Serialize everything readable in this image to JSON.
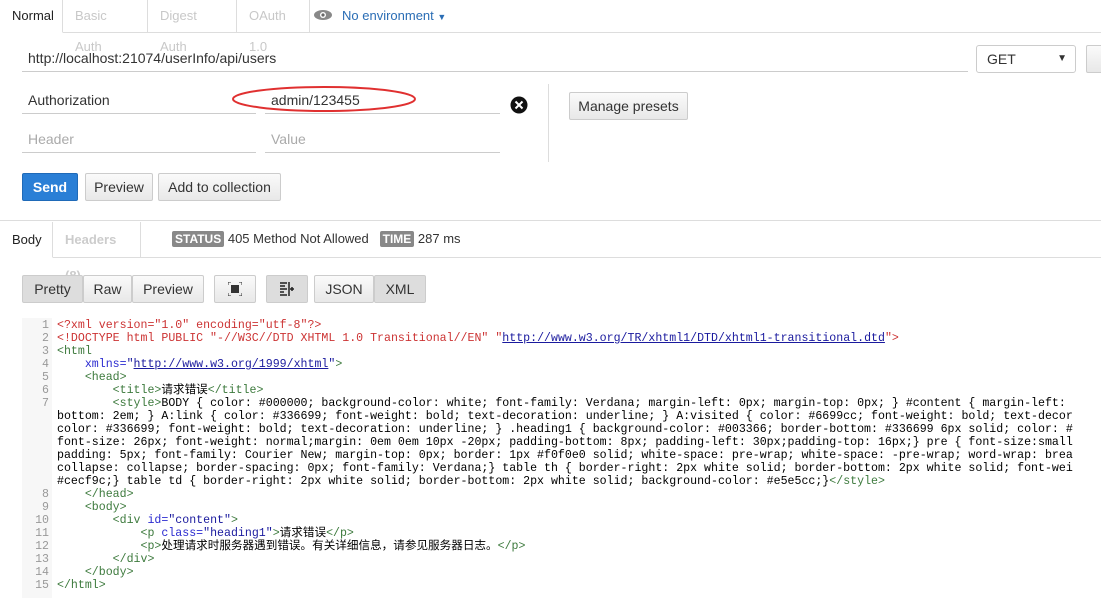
{
  "request_tabs": [
    "Normal",
    "Basic Auth",
    "Digest Auth",
    "OAuth 1.0"
  ],
  "environment": {
    "icon": "eye-icon",
    "label": "No environment"
  },
  "url": "http://localhost:21074/userInfo/api/users",
  "method": "GET",
  "headers": [
    {
      "key": "Authorization",
      "value": "admin/123455"
    },
    {
      "key_placeholder": "Header",
      "value_placeholder": "Value"
    }
  ],
  "manage_presets": "Manage presets",
  "actions": {
    "send": "Send",
    "preview": "Preview",
    "add": "Add to collection"
  },
  "response_tabs": [
    "Body",
    "Headers (8)"
  ],
  "status": {
    "label": "STATUS",
    "value": "405 Method Not Allowed",
    "time_label": "TIME",
    "time": "287 ms"
  },
  "view_modes": [
    "Pretty",
    "Raw",
    "Preview"
  ],
  "formats": [
    "JSON",
    "XML"
  ],
  "colors": {
    "send": "#2a7fd6",
    "highlight_ellipse": "#e03030"
  },
  "code": [
    {
      "n": "1",
      "t": [
        [
          "pi",
          "<?xml version=\"1.0\" encoding=\"utf-8\"?>"
        ]
      ]
    },
    {
      "n": "2",
      "t": [
        [
          "pi",
          "<!DOCTYPE html PUBLIC \"-//W3C//DTD XHTML 1.0 Transitional//EN\" \""
        ],
        [
          "url",
          "http://www.w3.org/TR/xhtml1/DTD/xhtml1-transitional.dtd"
        ],
        [
          "pi",
          "\">"
        ]
      ]
    },
    {
      "n": "3",
      "t": [
        [
          "tag",
          "<html"
        ]
      ]
    },
    {
      "n": "4",
      "t": [
        [
          "attr",
          "    xmlns="
        ],
        [
          "str",
          "\""
        ],
        [
          "url",
          "http://www.w3.org/1999/xhtml"
        ],
        [
          "str",
          "\""
        ],
        [
          "tag",
          ">"
        ]
      ]
    },
    {
      "n": "5",
      "t": [
        [
          "tag",
          "    <head>"
        ]
      ]
    },
    {
      "n": "6",
      "t": [
        [
          "tag",
          "        <title>"
        ],
        [
          "txt",
          "请求错误"
        ],
        [
          "tag",
          "</title>"
        ]
      ]
    },
    {
      "n": "7",
      "t": [
        [
          "tag",
          "        <style>"
        ],
        [
          "txt",
          "BODY { color: #000000; background-color: white; font-family: Verdana; margin-left: 0px; margin-top: 0px; } #content { margin-left:"
        ]
      ]
    },
    {
      "n": "",
      "t": [
        [
          "txt",
          "bottom: 2em; } A:link { color: #336699; font-weight: bold; text-decoration: underline; } A:visited { color: #6699cc; font-weight: bold; text-decor"
        ]
      ]
    },
    {
      "n": "",
      "t": [
        [
          "txt",
          "color: #336699; font-weight: bold; text-decoration: underline; } .heading1 { background-color: #003366; border-bottom: #336699 6px solid; color: #"
        ]
      ]
    },
    {
      "n": "",
      "t": [
        [
          "txt",
          "font-size: 26px; font-weight: normal;margin: 0em 0em 10px -20px; padding-bottom: 8px; padding-left: 30px;padding-top: 16px;} pre { font-size:small"
        ]
      ]
    },
    {
      "n": "",
      "t": [
        [
          "txt",
          "padding: 5px; font-family: Courier New; margin-top: 0px; border: 1px #f0f0e0 solid; white-space: pre-wrap; white-space: -pre-wrap; word-wrap: brea"
        ]
      ]
    },
    {
      "n": "",
      "t": [
        [
          "txt",
          "collapse: collapse; border-spacing: 0px; font-family: Verdana;} table th { border-right: 2px white solid; border-bottom: 2px white solid; font-wei"
        ]
      ]
    },
    {
      "n": "",
      "t": [
        [
          "txt",
          "#cecf9c;} table td { border-right: 2px white solid; border-bottom: 2px white solid; background-color: #e5e5cc;}"
        ],
        [
          "tag",
          "</style>"
        ]
      ]
    },
    {
      "n": "8",
      "t": [
        [
          "tag",
          "    </head>"
        ]
      ]
    },
    {
      "n": "9",
      "t": [
        [
          "tag",
          "    <body>"
        ]
      ]
    },
    {
      "n": "10",
      "t": [
        [
          "tag",
          "        <div "
        ],
        [
          "attr",
          "id="
        ],
        [
          "str",
          "\"content\""
        ],
        [
          "tag",
          ">"
        ]
      ]
    },
    {
      "n": "11",
      "t": [
        [
          "tag",
          "            <p "
        ],
        [
          "attr",
          "class="
        ],
        [
          "str",
          "\"heading1\""
        ],
        [
          "tag",
          ">"
        ],
        [
          "txt",
          "请求错误"
        ],
        [
          "tag",
          "</p>"
        ]
      ]
    },
    {
      "n": "12",
      "t": [
        [
          "tag",
          "            <p>"
        ],
        [
          "txt",
          "处理请求时服务器遇到错误。有关详细信息，请参见服务器日志。"
        ],
        [
          "tag",
          "</p>"
        ]
      ]
    },
    {
      "n": "13",
      "t": [
        [
          "tag",
          "        </div>"
        ]
      ]
    },
    {
      "n": "14",
      "t": [
        [
          "tag",
          "    </body>"
        ]
      ]
    },
    {
      "n": "15",
      "t": [
        [
          "tag",
          "</html>"
        ]
      ]
    }
  ]
}
